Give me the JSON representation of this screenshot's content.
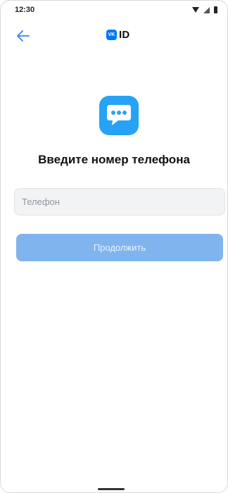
{
  "status_bar": {
    "time": "12:30",
    "icons": [
      "wifi-icon",
      "signal-icon",
      "battery-icon"
    ]
  },
  "header": {
    "back_icon": "arrow-left-icon",
    "logo_badge": "VK",
    "logo_text": "ID"
  },
  "app_icon": "chat-bubble-icon",
  "title": "Введите номер телефона",
  "phone_input": {
    "placeholder": "Телефон",
    "value": ""
  },
  "continue_button": {
    "label": "Продолжить",
    "state": "disabled"
  },
  "colors": {
    "accent": "#0077ff",
    "button_disabled": "#7fb4ee",
    "input_bg": "#f2f3f5",
    "app_icon": "#27a3f5"
  }
}
